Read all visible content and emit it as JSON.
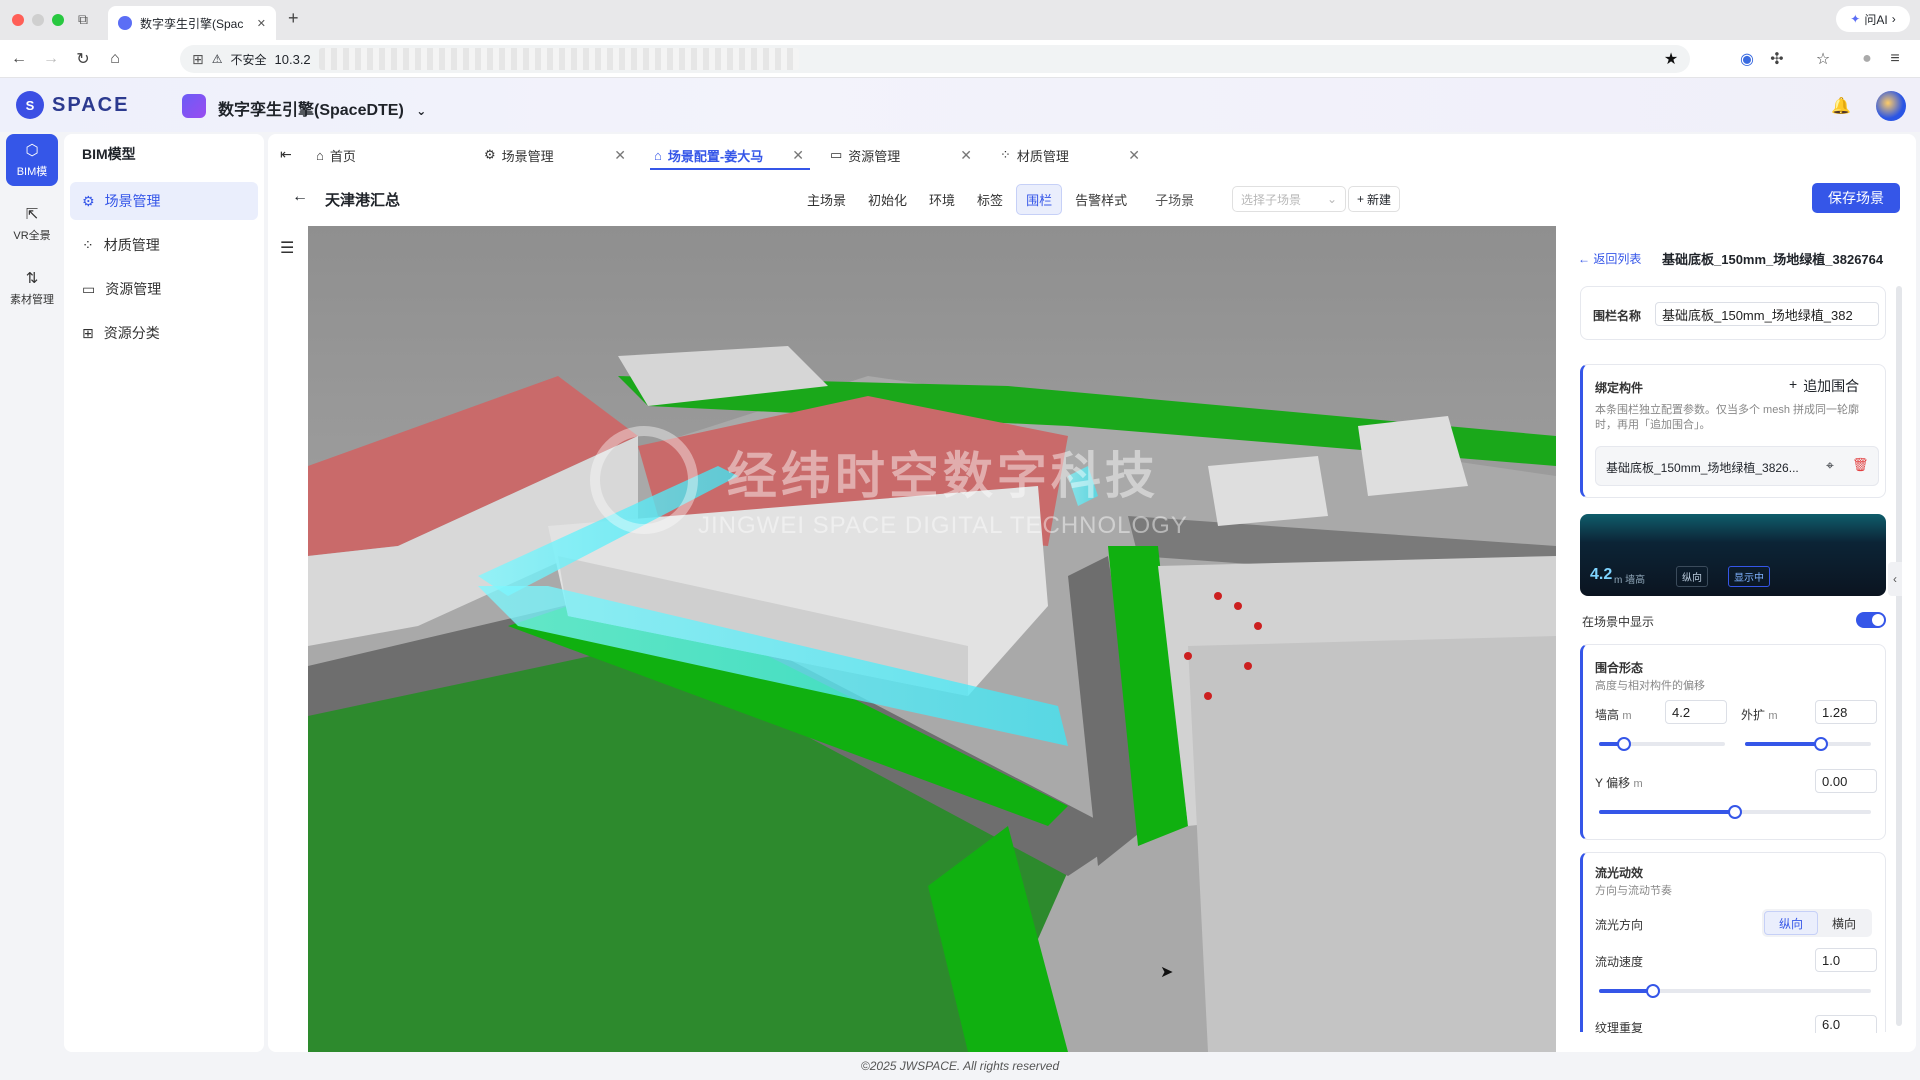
{
  "browser": {
    "tab_title": "数字孪生引擎(Spac",
    "tab_close": "✕",
    "new_tab": "+",
    "security_label": "不安全",
    "url_prefix": "10.3.2",
    "ai_label": "问AI"
  },
  "app": {
    "logo_text": "SPACE",
    "project_name": "数字孪生引擎(SpaceDTE)"
  },
  "rail": [
    {
      "label": "BIM模"
    },
    {
      "label": "VR全景"
    },
    {
      "label": "素材管理"
    }
  ],
  "sidebar": {
    "title": "BIM模型",
    "items": [
      {
        "label": "场景管理"
      },
      {
        "label": "材质管理"
      },
      {
        "label": "资源管理"
      },
      {
        "label": "资源分类"
      }
    ]
  },
  "page_tabs": [
    {
      "label": "首页"
    },
    {
      "label": "场景管理"
    },
    {
      "label": "场景配置-姜大马"
    },
    {
      "label": "资源管理"
    },
    {
      "label": "材质管理"
    }
  ],
  "subbar": {
    "title": "天津港汇总",
    "mode_tabs": [
      "主场景",
      "初始化",
      "环境",
      "标签",
      "围栏",
      "告警样式"
    ],
    "sub_scene_label": "子场景",
    "sub_scene_placeholder": "选择子场景",
    "new_label": "新建",
    "save_label": "保存场景"
  },
  "viewport": {
    "watermark_cn": "经纬时空数字科技",
    "watermark_en": "JINGWEI SPACE DIGITAL TECHNOLOGY"
  },
  "panel": {
    "back_label": "返回列表",
    "title": "基础底板_150mm_场地绿植_3826764",
    "fence_name_label": "围栏名称",
    "fence_name_value": "基础底板_150mm_场地绿植_382",
    "bind": {
      "title": "绑定构件",
      "add_label": "追加围合",
      "desc": "本条围栏独立配置参数。仅当多个 mesh 拼成同一轮廓时，再用「追加围合」。",
      "item": "基础底板_150mm_场地绿植_3826..."
    },
    "preview": {
      "height_value": "4.2",
      "height_unit": "m 墙高",
      "direction_badge": "纵向",
      "status_badge": "显示中"
    },
    "show_in_scene_label": "在场景中显示",
    "show_in_scene": true,
    "shape": {
      "title": "围合形态",
      "desc": "高度与相对构件的偏移",
      "wall_height_label": "墙高",
      "wall_height_unit": "m",
      "wall_height_value": "4.2",
      "wall_height_level": 0.2,
      "expand_label": "外扩",
      "expand_unit": "m",
      "expand_value": "1.28",
      "expand_level": 0.6,
      "y_offset_label": "Y 偏移",
      "y_offset_unit": "m",
      "y_offset_value": "0.00",
      "y_offset_level": 0.5
    },
    "flow": {
      "title": "流光动效",
      "desc": "方向与流动节奏",
      "direction_label": "流光方向",
      "direction_options": [
        "纵向",
        "横向"
      ],
      "direction_selected": "纵向",
      "speed_label": "流动速度",
      "speed_value": "1.0",
      "speed_level": 0.2,
      "repeat_label": "纹理重复",
      "repeat_value": "6.0"
    }
  },
  "footer": "©2025 JWSPACE. All rights reserved",
  "colors": {
    "primary": "#3556e8",
    "fence_glow": "#5ff3ff",
    "grass": "#10b010",
    "roof": "#c96a6a"
  }
}
